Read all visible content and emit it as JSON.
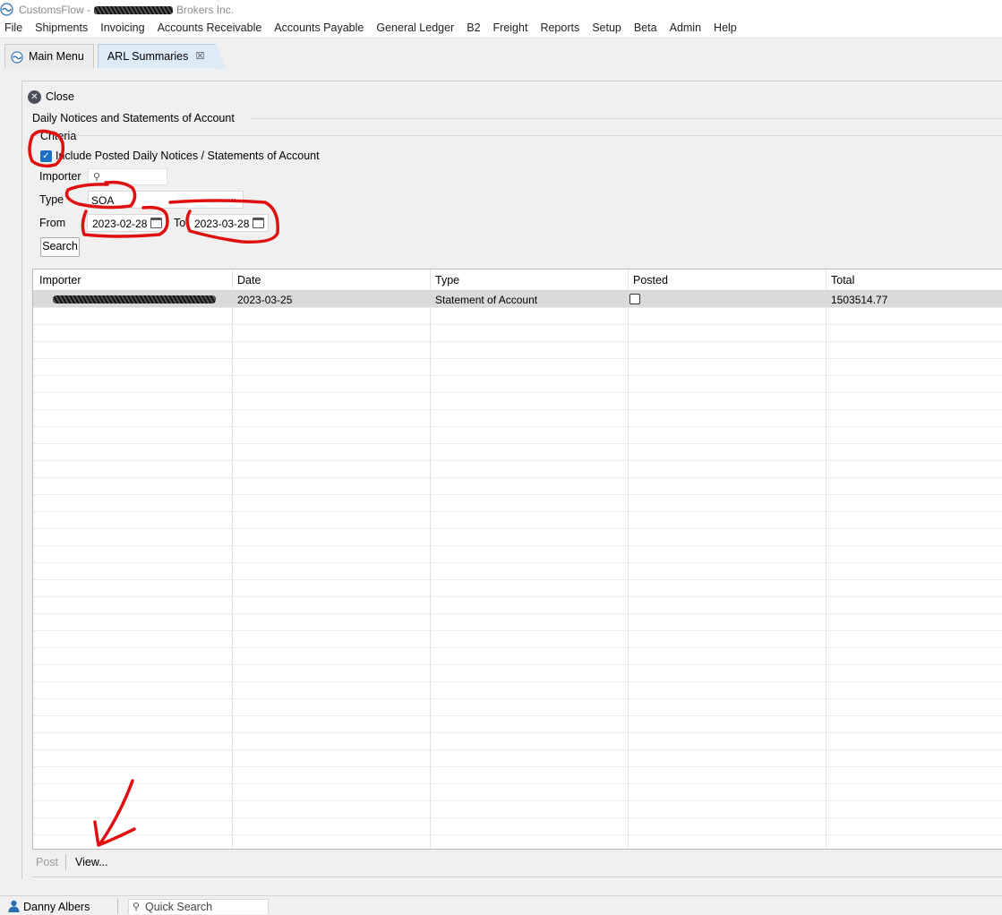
{
  "window": {
    "title_prefix": "CustomsFlow -",
    "title_suffix": "Brokers Inc."
  },
  "menu": [
    "File",
    "Shipments",
    "Invoicing",
    "Accounts Receivable",
    "Accounts Payable",
    "General Ledger",
    "B2",
    "Freight",
    "Reports",
    "Setup",
    "Beta",
    "Admin",
    "Help"
  ],
  "tabs": {
    "main_menu": "Main Menu",
    "arl_summaries": "ARL Summaries",
    "close_glyph": "☒"
  },
  "toolbar": {
    "close_label": "Close",
    "close_glyph": "✕"
  },
  "section": {
    "title": "Daily Notices and Statements of Account",
    "criteria_legend": "Criteria",
    "include_posted_label": "Include Posted Daily Notices / Statements of Account",
    "include_posted_checked": true,
    "check_glyph": "✓",
    "importer_label": "Importer",
    "importer_value": "",
    "type_label": "Type",
    "type_value": "SOA",
    "from_label": "From",
    "from_value": "2023-02-28",
    "to_label": "To",
    "to_value": "2023-03-28",
    "search_label": "Search",
    "search_glyph": "⚲",
    "chevron_glyph": "⌄"
  },
  "table": {
    "columns": [
      "Importer",
      "Date",
      "Type",
      "Posted",
      "Total"
    ],
    "rows": [
      {
        "importer": "",
        "date": "2023-03-25",
        "type": "Statement of Account",
        "posted": false,
        "total": "1503514.77"
      }
    ]
  },
  "actions": {
    "post_label": "Post",
    "view_label": "View..."
  },
  "status": {
    "user_name": "Danny Albers",
    "quick_search_placeholder": "Quick Search"
  },
  "colors": {
    "annotation_red": "#e01010",
    "checkbox_blue": "#1d6fc4",
    "tab_active": "#ddeaf7",
    "selected_row": "#dadada"
  }
}
